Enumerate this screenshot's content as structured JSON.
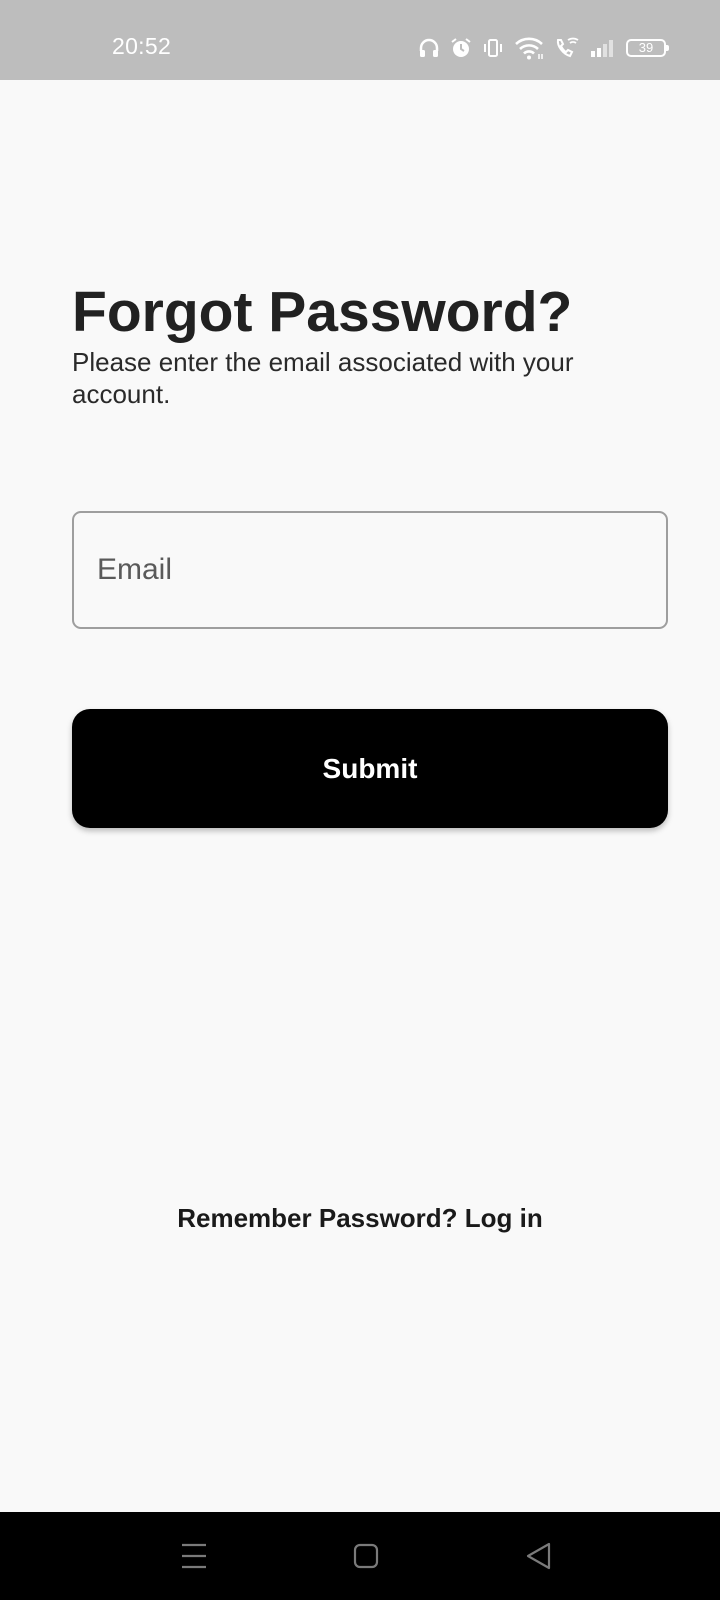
{
  "status_bar": {
    "time": "20:52",
    "battery_level": "39",
    "icons": [
      "headphones-icon",
      "alarm-icon",
      "vibrate-icon",
      "wifi-icon",
      "wifi-calling-icon",
      "signal-icon",
      "battery-icon"
    ]
  },
  "page": {
    "title": "Forgot Password?",
    "subtitle": "Please enter the email associated with your account."
  },
  "form": {
    "email_placeholder": "Email",
    "email_value": "",
    "submit_label": "Submit"
  },
  "footer": {
    "login_link": "Remember Password? Log in"
  },
  "nav_bar": {
    "buttons": [
      "menu-icon",
      "home-icon",
      "back-icon"
    ]
  },
  "colors": {
    "background": "#f9f9f9",
    "status_bar": "#bdbdbd",
    "button_bg": "#000000",
    "button_text": "#ffffff",
    "nav_bar": "#000000"
  }
}
